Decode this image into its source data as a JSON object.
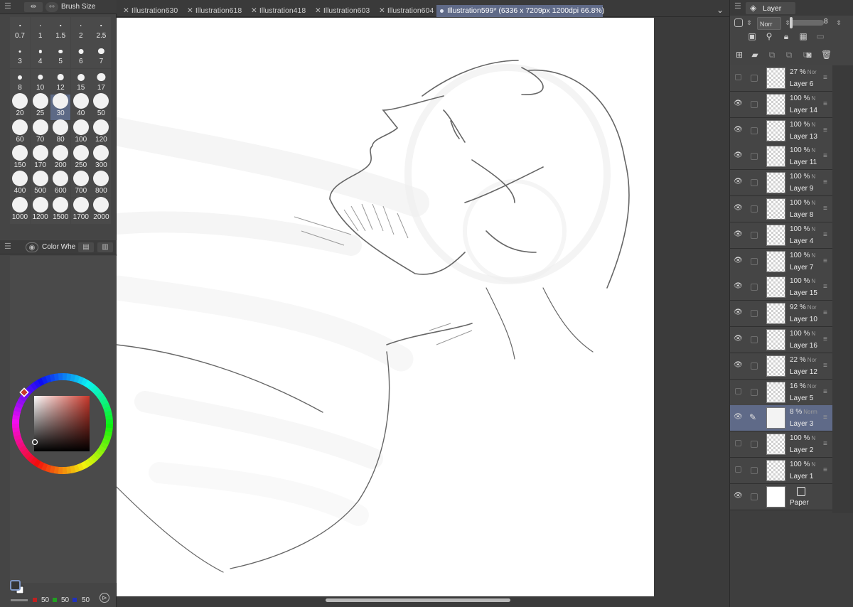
{
  "brush_panel": {
    "tab_label": "Brush Size",
    "sizes": [
      "0.7",
      "1",
      "1.5",
      "2",
      "2.5",
      "3",
      "4",
      "5",
      "6",
      "7",
      "8",
      "10",
      "12",
      "15",
      "17",
      "20",
      "25",
      "30",
      "40",
      "50",
      "60",
      "70",
      "80",
      "100",
      "120",
      "150",
      "170",
      "200",
      "250",
      "300",
      "400",
      "500",
      "600",
      "700",
      "800",
      "1000",
      "1200",
      "1500",
      "1700",
      "2000"
    ],
    "selected": "30"
  },
  "color_panel": {
    "tab_label": "Color Whe"
  },
  "color_values": {
    "r": "50",
    "g": "50",
    "b": "50"
  },
  "tabs": [
    {
      "label": "Illustration630"
    },
    {
      "label": "Illustration618"
    },
    {
      "label": "Illustration418"
    },
    {
      "label": "Illustration603"
    },
    {
      "label": "Illustration604"
    },
    {
      "label": "Illustration599* (6336 x 7209px 1200dpi 66.8%)",
      "active": true
    }
  ],
  "layer_panel": {
    "tab_label": "Layer",
    "blend_mode": "Norr",
    "opacity_value": "8",
    "layers": [
      {
        "opacity": "27 %",
        "blend": "Nor",
        "name": "Layer 6",
        "visible": false
      },
      {
        "opacity": "100 %",
        "blend": "N",
        "name": "Layer 14",
        "visible": true
      },
      {
        "opacity": "100 %",
        "blend": "N",
        "name": "Layer 13",
        "visible": true
      },
      {
        "opacity": "100 %",
        "blend": "N",
        "name": "Layer 11",
        "visible": true
      },
      {
        "opacity": "100 %",
        "blend": "N",
        "name": "Layer 9",
        "visible": true
      },
      {
        "opacity": "100 %",
        "blend": "N",
        "name": "Layer 8",
        "visible": true
      },
      {
        "opacity": "100 %",
        "blend": "N",
        "name": "Layer 4",
        "visible": true
      },
      {
        "opacity": "100 %",
        "blend": "N",
        "name": "Layer 7",
        "visible": true
      },
      {
        "opacity": "100 %",
        "blend": "N",
        "name": "Layer 15",
        "visible": true
      },
      {
        "opacity": "92 %",
        "blend": "Nor",
        "name": "Layer 10",
        "visible": true
      },
      {
        "opacity": "100 %",
        "blend": "N",
        "name": "Layer 16",
        "visible": true
      },
      {
        "opacity": "22 %",
        "blend": "Nor",
        "name": "Layer 12",
        "visible": true
      },
      {
        "opacity": "16 %",
        "blend": "Nor",
        "name": "Layer 5",
        "visible": false
      },
      {
        "opacity": "8 %",
        "blend": "Norm",
        "name": "Layer 3",
        "visible": true,
        "selected": true
      },
      {
        "opacity": "100 %",
        "blend": "N",
        "name": "Layer 2",
        "visible": false
      },
      {
        "opacity": "100 %",
        "blend": "N",
        "name": "Layer 1",
        "visible": false
      },
      {
        "opacity": "",
        "blend": "",
        "name": "Paper",
        "visible": true,
        "paper": true
      }
    ]
  },
  "colors": {
    "accent": "#5f6a88",
    "panel_bg": "#454545",
    "canvas_bg": "#3b3b3b"
  }
}
